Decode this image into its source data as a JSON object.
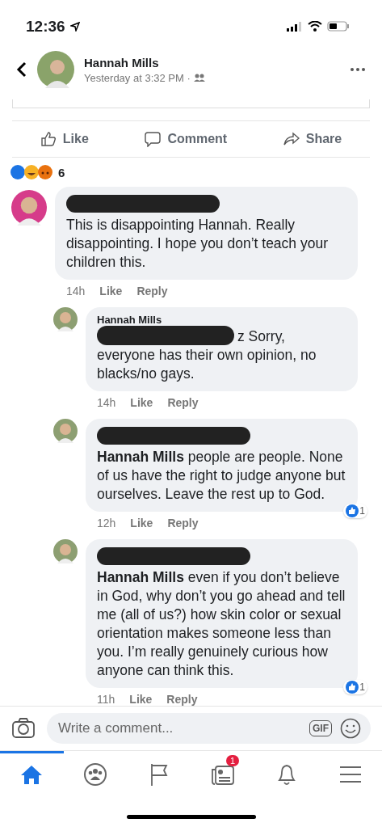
{
  "status_bar": {
    "time": "12:36"
  },
  "post_header": {
    "name": "Hannah Mills",
    "subtitle": "Yesterday at 3:32 PM ·"
  },
  "actions": [
    "Like",
    "Comment",
    "Share"
  ],
  "reactions": {
    "count": "6"
  },
  "comments": [
    {
      "kind": "top",
      "author_redacted": true,
      "text": "This is disappointing Hannah. Really disappointing. I hope you don’t teach your children this.",
      "time": "14h",
      "like": "Like",
      "reply": "Reply"
    },
    {
      "kind": "reply",
      "author": "Hannah Mills",
      "text_redacted": true,
      "text": "z Sorry, everyone has their own opinion, no blacks/no gays.",
      "time": "14h",
      "like": "Like",
      "reply": "Reply"
    },
    {
      "kind": "reply",
      "author_redacted": true,
      "text": "**Hannah Mills** people are people. None of us have the right to judge anyone but ourselves. Leave the rest up to God.",
      "time": "12h",
      "like": "Like",
      "reply": "Reply",
      "likes": "1"
    },
    {
      "kind": "reply",
      "author_redacted": true,
      "text": "**Hannah Mills** even if you don’t believe in God, why don’t you go ahead and tell me (all of us?) how skin color or sexual orientation makes someone less than you. I’m really genuinely curious how anyone can think this.",
      "time": "11h",
      "like": "Like",
      "reply": "Reply",
      "likes": "1"
    }
  ],
  "composer": {
    "placeholder": "Write a comment..."
  },
  "gif_label": "GIF",
  "tabs": [
    {
      "kind": "home",
      "selected": true
    },
    {
      "kind": "groups",
      "selected": false
    },
    {
      "kind": "pages",
      "selected": false
    },
    {
      "kind": "news",
      "selected": false,
      "badge": "1"
    },
    {
      "kind": "notifications",
      "selected": false
    },
    {
      "kind": "menu",
      "selected": false
    }
  ]
}
